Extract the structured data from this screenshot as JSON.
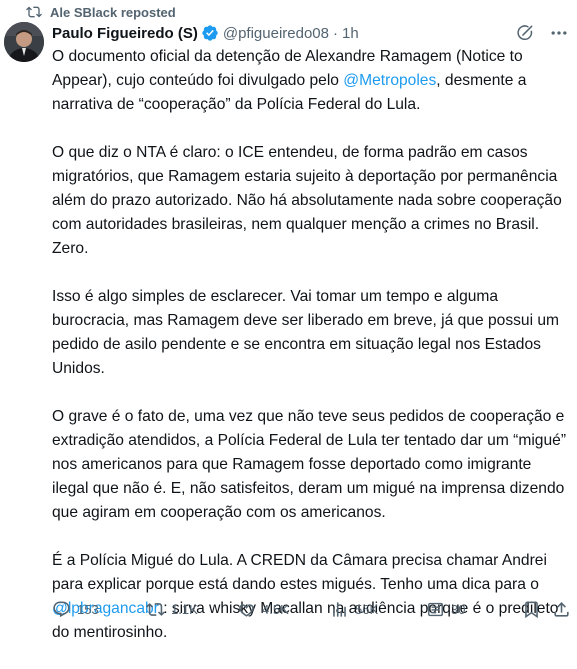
{
  "social_context": {
    "text": "Ale SBlack reposted",
    "icon": "repost-icon"
  },
  "author": {
    "name": "Paulo Figueiredo (S)",
    "handle": "@pfigueiredo08",
    "separator": "·",
    "time": "1h",
    "verified": true,
    "verified_color": "#1d9bf0"
  },
  "tweet": {
    "p1_a": "O documento oficial da detenção de Alexandre Ramagem (Notice to Appear), cujo conteúdo foi divulgado pelo ",
    "p1_mention": "@Metropoles",
    "p1_b": ", desmente a narrativa de “cooperação” da Polícia Federal do Lula.",
    "p2": "O que diz o NTA é claro: o ICE entendeu, de forma padrão em casos migratórios, que Ramagem estaria sujeito à deportação por permanência além do prazo autorizado. Não há absolutamente nada sobre cooperação com autoridades brasileiras, nem qualquer menção a crimes no Brasil. Zero.",
    "p3": "Isso é algo simples de esclarecer. Vai tomar um tempo e alguma burocracia, mas Ramagem deve ser liberado em breve, já que possui um pedido de asilo pendente e se encontra em situação legal nos Estados Unidos.",
    "p4": "O grave é o fato de, uma vez que não teve seus pedidos de cooperação e extradição atendidos, a Polícia Federal de Lula ter tentado dar um “migué” nos americanos para que Ramagem fosse deportado como imigrante ilegal que não é. E, não satisfeitos, deram um migué na imprensa dizendo que agiram em cooperação com os americanos.",
    "p5_a": "É a Polícia Migué do Lula. A CREDN da Câmara precisa chamar Andrei para explicar porque está dando estes migués. Tenho uma dica para o ",
    "p5_mention": "@lpbragancabr",
    "p5_b": " : sirva whisky Macallan na audiência porque é o predileto do mentirosinho."
  },
  "actions": {
    "replies": "153",
    "reposts": "1.1K",
    "likes": "4.5K",
    "views": "56K",
    "notes": "30"
  },
  "colors": {
    "text": "#0f1419",
    "secondary": "#536471",
    "accent": "#1d9bf0"
  }
}
